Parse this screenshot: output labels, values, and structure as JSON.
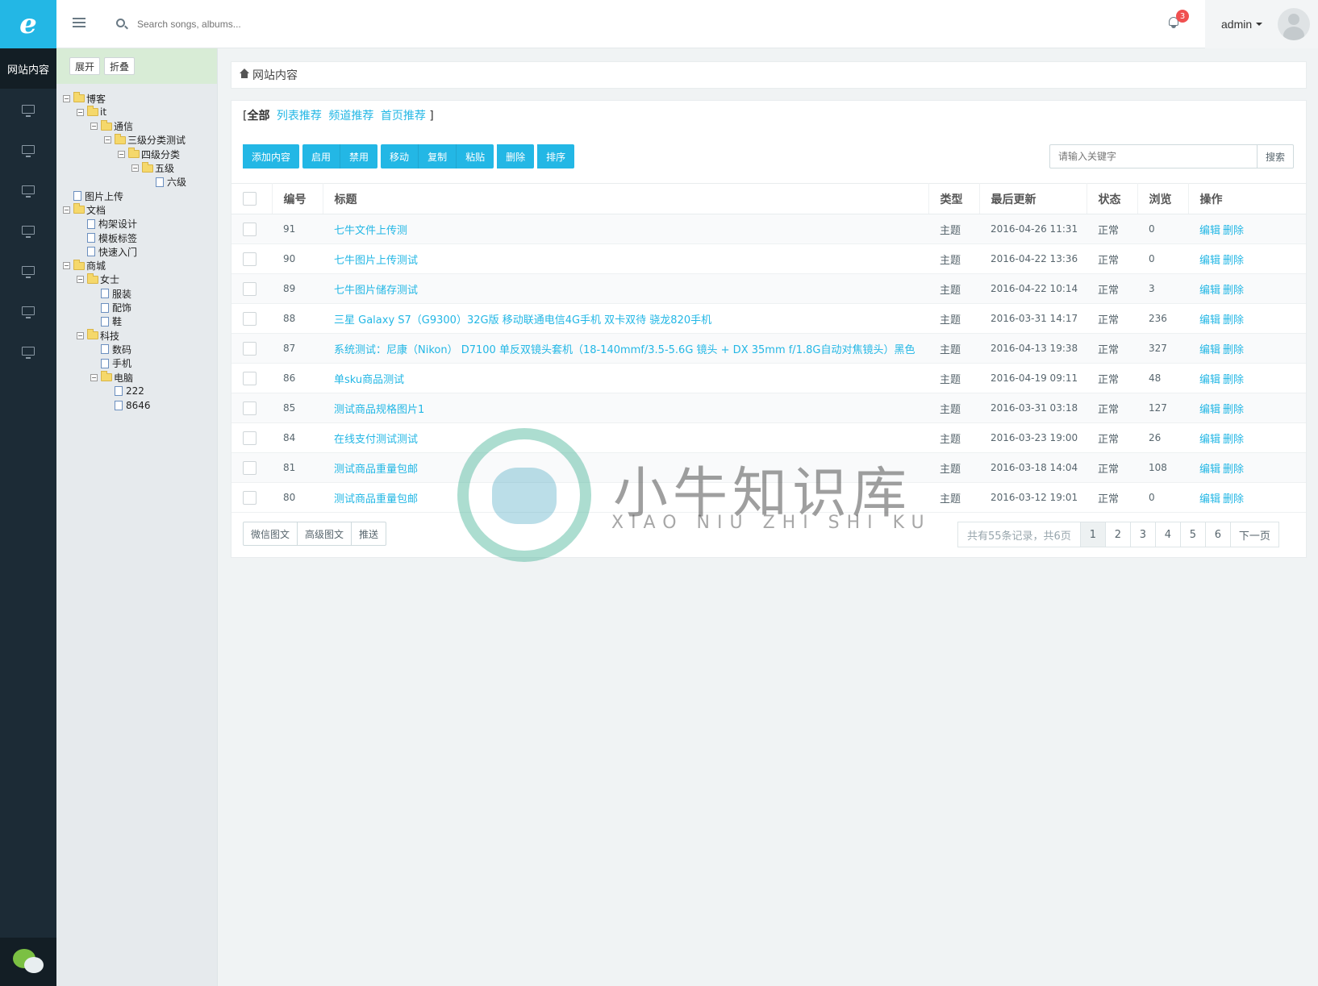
{
  "rail": {
    "logo": "e",
    "active_label": "网站内容",
    "items": [
      "monitor-icon",
      "monitor-icon",
      "monitor-icon",
      "monitor-icon",
      "monitor-icon",
      "monitor-icon",
      "monitor-icon"
    ]
  },
  "header": {
    "search_placeholder": "Search songs, albums...",
    "notification_count": "3",
    "user_name": "admin"
  },
  "tree": {
    "expand_label": "展开",
    "collapse_label": "折叠",
    "nodes": [
      {
        "label": "博客",
        "type": "folder",
        "toggle": "−"
      },
      {
        "label": "it",
        "type": "folder",
        "toggle": "−"
      },
      {
        "label": "通信",
        "type": "folder",
        "toggle": "−"
      },
      {
        "label": "三级分类测试",
        "type": "folder",
        "toggle": "−"
      },
      {
        "label": "四级分类",
        "type": "folder",
        "toggle": "−"
      },
      {
        "label": "五级",
        "type": "folder",
        "toggle": "−"
      },
      {
        "label": "六级",
        "type": "file"
      },
      {
        "label": "图片上传",
        "type": "file"
      },
      {
        "label": "文档",
        "type": "folder",
        "toggle": "−"
      },
      {
        "label": "构架设计",
        "type": "file"
      },
      {
        "label": "模板标签",
        "type": "file"
      },
      {
        "label": "快速入门",
        "type": "file"
      },
      {
        "label": "商城",
        "type": "folder",
        "toggle": "−"
      },
      {
        "label": "女士",
        "type": "folder",
        "toggle": "−"
      },
      {
        "label": "服装",
        "type": "file"
      },
      {
        "label": "配饰",
        "type": "file"
      },
      {
        "label": "鞋",
        "type": "file"
      },
      {
        "label": "科技",
        "type": "folder",
        "toggle": "−"
      },
      {
        "label": "数码",
        "type": "file"
      },
      {
        "label": "手机",
        "type": "file"
      },
      {
        "label": "电脑",
        "type": "folder",
        "toggle": "−"
      },
      {
        "label": "222",
        "type": "file"
      },
      {
        "label": "8646",
        "type": "file"
      }
    ]
  },
  "breadcrumb": {
    "label": "网站内容"
  },
  "filters": {
    "bracket_open": "[",
    "bracket_close": "]",
    "active": "全部",
    "links": [
      "列表推荐",
      "频道推荐",
      "首页推荐"
    ]
  },
  "actions": {
    "add": "添加内容",
    "enable": "启用",
    "disable": "禁用",
    "move": "移动",
    "copy": "复制",
    "paste": "粘贴",
    "delete": "删除",
    "sort": "排序"
  },
  "search": {
    "placeholder": "请输入关键字",
    "button": "搜索"
  },
  "table": {
    "headers": {
      "id": "编号",
      "title": "标题",
      "type": "类型",
      "updated": "最后更新",
      "status": "状态",
      "views": "浏览",
      "ops": "操作"
    },
    "edit_label": "编辑",
    "delete_label": "删除",
    "rows": [
      {
        "id": "91",
        "title": "七牛文件上传测",
        "type": "主题",
        "updated": "2016-04-26 11:31",
        "status": "正常",
        "views": "0"
      },
      {
        "id": "90",
        "title": "七牛图片上传测试",
        "type": "主题",
        "updated": "2016-04-22 13:36",
        "status": "正常",
        "views": "0"
      },
      {
        "id": "89",
        "title": "七牛图片储存测试",
        "type": "主题",
        "updated": "2016-04-22 10:14",
        "status": "正常",
        "views": "3"
      },
      {
        "id": "88",
        "title": "三星 Galaxy S7（G9300）32G版 移动联通电信4G手机 双卡双待 骁龙820手机",
        "type": "主题",
        "updated": "2016-03-31 14:17",
        "status": "正常",
        "views": "236"
      },
      {
        "id": "87",
        "title": "系统测试：尼康（Nikon） D7100 单反双镜头套机（18-140mmf/3.5-5.6G 镜头 + DX 35mm f/1.8G自动对焦镜头）黑色",
        "type": "主题",
        "updated": "2016-04-13 19:38",
        "status": "正常",
        "views": "327"
      },
      {
        "id": "86",
        "title": "单sku商品测试",
        "type": "主题",
        "updated": "2016-04-19 09:11",
        "status": "正常",
        "views": "48"
      },
      {
        "id": "85",
        "title": "测试商品规格图片1",
        "type": "主题",
        "updated": "2016-03-31 03:18",
        "status": "正常",
        "views": "127"
      },
      {
        "id": "84",
        "title": "在线支付测试测试",
        "type": "主题",
        "updated": "2016-03-23 19:00",
        "status": "正常",
        "views": "26"
      },
      {
        "id": "81",
        "title": "测试商品重量包邮",
        "type": "主题",
        "updated": "2016-03-18 14:04",
        "status": "正常",
        "views": "108"
      },
      {
        "id": "80",
        "title": "测试商品重量包邮",
        "type": "主题",
        "updated": "2016-03-12 19:01",
        "status": "正常",
        "views": "0"
      }
    ]
  },
  "bottom_actions": [
    "微信图文",
    "高级图文",
    "推送"
  ],
  "pagination": {
    "info": "共有55条记录，共6页",
    "pages": [
      "1",
      "2",
      "3",
      "4",
      "5",
      "6"
    ],
    "next": "下一页",
    "current": "1"
  },
  "watermark": {
    "title": "小牛知识库",
    "subtitle": "XIAO NIU ZHI SHI KU"
  },
  "colors": {
    "accent": "#23b7e5",
    "rail": "#1c2b36",
    "badge": "#f05050"
  }
}
